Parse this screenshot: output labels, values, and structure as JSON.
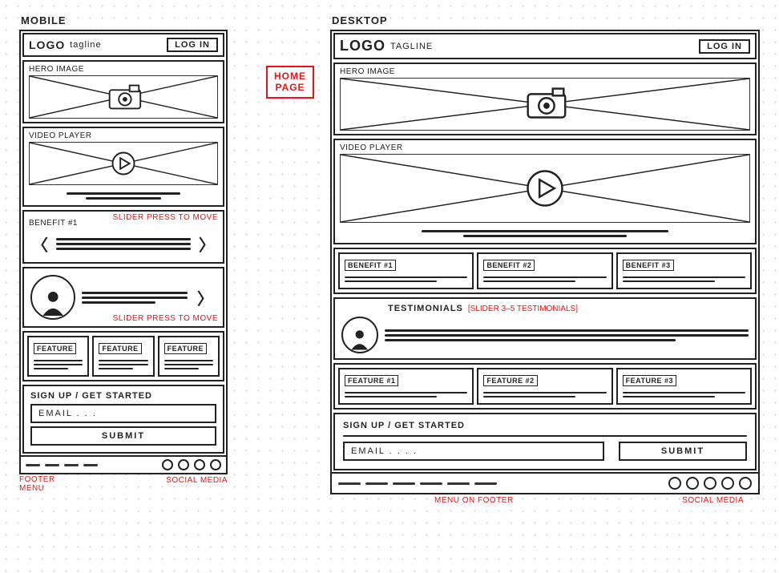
{
  "page_tag": "HOME\nPAGE",
  "mobile": {
    "label": "MOBILE",
    "logo": "LOGO",
    "tagline": "tagline",
    "login": "LOG IN",
    "hero_label": "HERO IMAGE",
    "video_label": "VIDEO PLAYER",
    "benefit_label": "BENEFIT #1",
    "slider_note": "SLIDER PRESS TO MOVE",
    "testimonial_slider_note": "SLIDER PRESS TO MOVE",
    "features": [
      "FEATURE",
      "FEATURE",
      "FEATURE"
    ],
    "signup_title": "SIGN UP / GET STARTED",
    "email_placeholder": "EMAIL . . .",
    "submit_label": "SUBMIT",
    "footer_menu_label": "FOOTER\nMENU",
    "social_label": "SOCIAL MEDIA"
  },
  "desktop": {
    "label": "DESKTOP",
    "logo": "LOGO",
    "tagline": "TAGLINE",
    "login": "LOG IN",
    "hero_label": "HERO IMAGE",
    "video_label": "VIDEO PLAYER",
    "benefits": [
      "BENEFIT #1",
      "BENEFIT #2",
      "BENEFIT #3"
    ],
    "testimonials_label": "TESTIMONIALS",
    "testimonials_anno": "[SLIDER 3–5 TESTIMONIALS]",
    "features": [
      "FEATURE #1",
      "FEATURE #2",
      "FEATURE #3"
    ],
    "signup_title": "SIGN UP / GET STARTED",
    "email_placeholder": "EMAIL . . . .",
    "submit_label": "SUBMIT",
    "footer_menu_label": "MENU ON FOOTER",
    "social_label": "SOCIAL MEDIA"
  }
}
